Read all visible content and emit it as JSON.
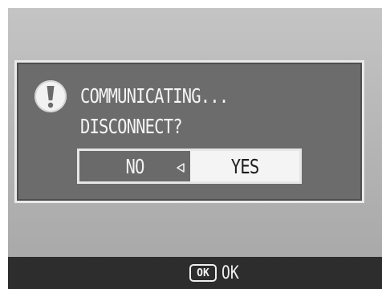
{
  "dialog": {
    "message_line1": "COMMUNICATING...",
    "message_line2": "DISCONNECT?",
    "icon": "exclamation-icon",
    "options": {
      "no_label": "NO",
      "yes_label": "YES",
      "selected": "YES",
      "selector_icon": "triangle-pointer-icon"
    }
  },
  "footer": {
    "ok_key_label": "OK",
    "ok_label": "OK",
    "ok_key_icon": "ok-button-icon"
  },
  "colors": {
    "screen_background": "#b8b8b8",
    "dialog_background": "#6c6c6c",
    "selected_option": "#f4f4f4",
    "footer_bar": "#2d2d2d"
  }
}
